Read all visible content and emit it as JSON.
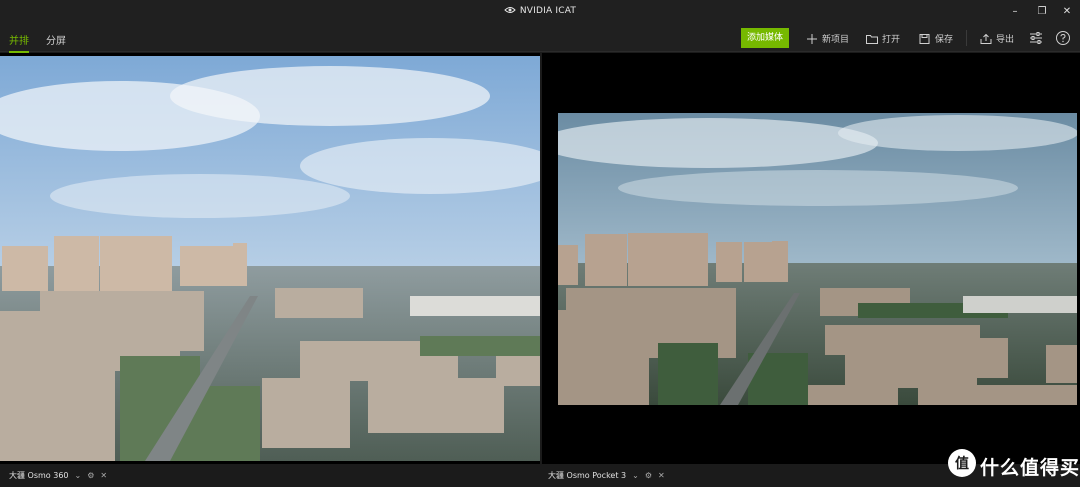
{
  "window": {
    "title": "NVIDIA ICAT",
    "controls": {
      "minimize": "–",
      "maximize": "❐",
      "close": "✕"
    }
  },
  "tabs": [
    {
      "label": "并排",
      "active": true
    },
    {
      "label": "分屏",
      "active": false
    }
  ],
  "toolbar": {
    "add_media": "添加媒体",
    "new_project": "新项目",
    "open": "打开",
    "save": "保存",
    "export": "导出",
    "settings_icon": "sliders-icon",
    "help_icon": "help-icon"
  },
  "sources": [
    {
      "name": "大疆 Osmo 360",
      "dropdown": "⌄"
    },
    {
      "name": "大疆 Osmo Pocket 3",
      "dropdown": "⌄"
    }
  ],
  "watermark": {
    "text": "什么值得买",
    "logo": "值"
  },
  "colors": {
    "accent": "#76b900",
    "background": "#1b1b1b"
  }
}
